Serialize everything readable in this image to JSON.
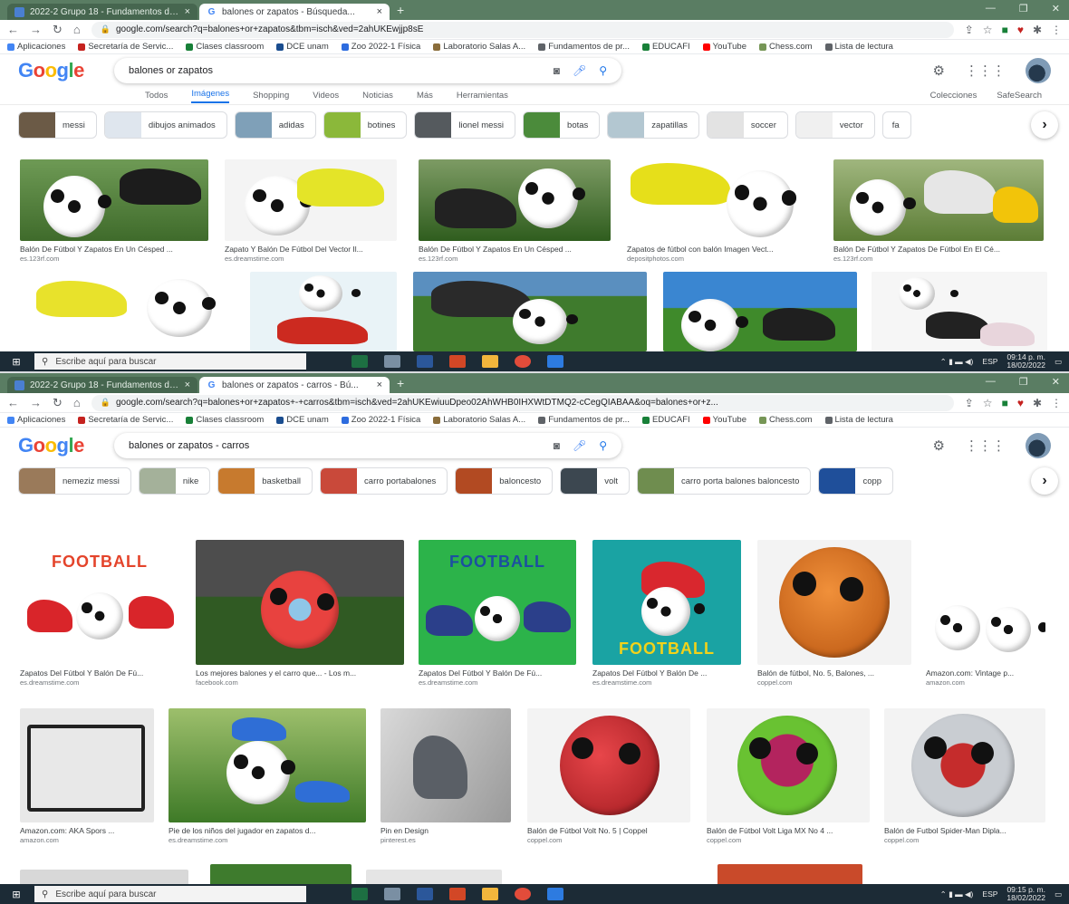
{
  "shot1": {
    "tabs": [
      "2022-2 Grupo 18 - Fundamentos de...",
      "balones or zapatos - Búsqueda..."
    ],
    "url": "google.com/search?q=balones+or+zapatos&tbm=isch&ved=2ahUKEwjjp8sE",
    "query": "balones or zapatos",
    "nav_tabs": [
      "Todos",
      "Imágenes",
      "Shopping",
      "Videos",
      "Noticias",
      "Más",
      "Herramientas"
    ],
    "tools_right": [
      "Colecciones",
      "SafeSearch"
    ],
    "chips": [
      "messi",
      "dibujos animados",
      "adidas",
      "botines",
      "lionel messi",
      "botas",
      "zapatillas",
      "soccer",
      "vector",
      "fa"
    ],
    "results": [
      {
        "cap": "Balón De Fútbol Y Zapatos En Un Césped ...",
        "src": "es.123rf.com"
      },
      {
        "cap": "Zapato Y Balón De Fútbol Del Vector Il...",
        "src": "es.dreamstime.com"
      },
      {
        "cap": "Balón De Fútbol Y Zapatos En Un Césped ...",
        "src": "es.123rf.com"
      },
      {
        "cap": "Zapatos de fútbol con balón Imagen Vect...",
        "src": "depositphotos.com"
      },
      {
        "cap": "Balón De Fútbol Y Zapatos De Fútbol En El Cé...",
        "src": "es.123rf.com"
      }
    ],
    "taskbar_search": "Escribe aquí para buscar",
    "clock_time": "09:14 p. m.",
    "clock_date": "18/02/2022"
  },
  "shot2": {
    "tabs": [
      "2022-2 Grupo 18 - Fundamentos de...",
      "balones or zapatos - carros - Bú..."
    ],
    "url": "google.com/search?q=balones+or+zapatos+-+carros&tbm=isch&ved=2ahUKEwiuuDpeo02AhWHB0IHXWtDTMQ2-cCegQIABAA&oq=balones+or+z...",
    "query": "balones or zapatos - carros",
    "chips": [
      "nemeziz messi",
      "nike",
      "basketball",
      "carro portabalones",
      "baloncesto",
      "volt",
      "carro porta balones baloncesto",
      "copp"
    ],
    "row1": [
      {
        "cap": "Zapatos Del Fútbol Y Balón De Fú...",
        "src": "es.dreamstime.com"
      },
      {
        "cap": "Los mejores balones y el carro que... - Los m...",
        "src": "facebook.com"
      },
      {
        "cap": "Zapatos Del Fútbol Y Balón De Fú...",
        "src": "es.dreamstime.com"
      },
      {
        "cap": "Zapatos Del Fútbol Y Balón De ...",
        "src": "es.dreamstime.com"
      },
      {
        "cap": "Balón de fútbol, No. 5, Balones, ...",
        "src": "coppel.com"
      },
      {
        "cap": "Amazon.com: Vintage p...",
        "src": "amazon.com"
      }
    ],
    "row2": [
      {
        "cap": "Amazon.com: AKA Spors ...",
        "src": "amazon.com"
      },
      {
        "cap": "Pie de los niños del jugador en zapatos d...",
        "src": "es.dreamstime.com"
      },
      {
        "cap": "Pin en Design",
        "src": "pinterest.es"
      },
      {
        "cap": "Balón de Fútbol Volt No. 5 | Coppel",
        "src": "coppel.com"
      },
      {
        "cap": "Balón de Fútbol Volt Liga MX No 4 ...",
        "src": "coppel.com"
      },
      {
        "cap": "Balón de Futbol Spider-Man Dipla...",
        "src": "coppel.com"
      }
    ],
    "football_label": "FOOTBALL",
    "taskbar_search": "Escribe aquí para buscar",
    "clock_time": "09:15 p. m.",
    "clock_date": "18/02/2022"
  },
  "bookmarks": [
    "Aplicaciones",
    "Secretaría de Servic...",
    "Clases classroom",
    "DCE unam",
    "Zoo 2022-1 Física",
    "Laboratorio Salas A...",
    "Fundamentos de pr...",
    "EDUCAFI",
    "YouTube",
    "Chess.com",
    "Lista de lectura"
  ],
  "colors": {
    "accent": "#1a73e8",
    "chrome": "#5a7d63",
    "taskbar": "#1c2b36"
  }
}
